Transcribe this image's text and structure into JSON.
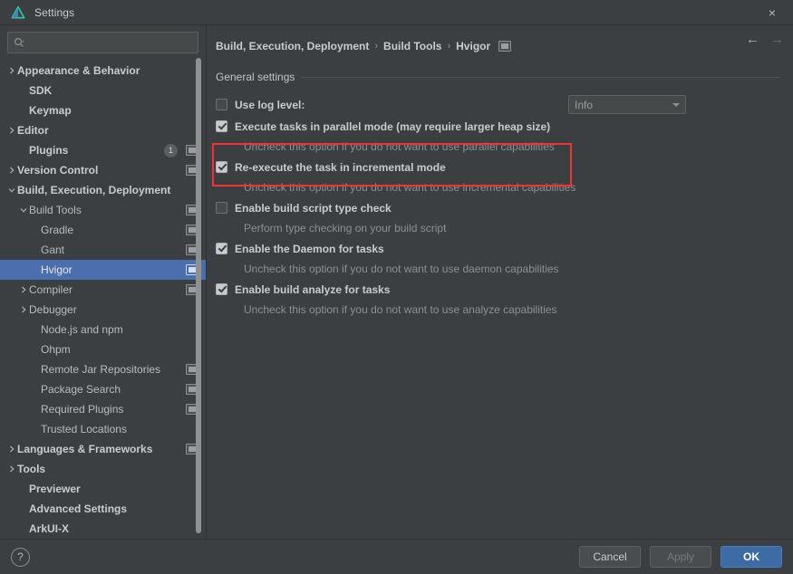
{
  "window": {
    "title": "Settings",
    "app_icon": "deveco-logo-icon",
    "close_label": "×"
  },
  "sidebar": {
    "search": {
      "value": "",
      "placeholder": "",
      "icon": "search-icon"
    },
    "items": [
      {
        "label": "Appearance & Behavior",
        "indent": 0,
        "arrow": "›",
        "bold": true,
        "selected": false,
        "module_icon": false,
        "badge": ""
      },
      {
        "label": "SDK",
        "indent": 1,
        "arrow": "",
        "bold": true,
        "selected": false,
        "module_icon": false,
        "badge": ""
      },
      {
        "label": "Keymap",
        "indent": 1,
        "arrow": "",
        "bold": true,
        "selected": false,
        "module_icon": false,
        "badge": ""
      },
      {
        "label": "Editor",
        "indent": 0,
        "arrow": "›",
        "bold": true,
        "selected": false,
        "module_icon": false,
        "badge": ""
      },
      {
        "label": "Plugins",
        "indent": 1,
        "arrow": "",
        "bold": true,
        "selected": false,
        "module_icon": true,
        "badge": "1"
      },
      {
        "label": "Version Control",
        "indent": 0,
        "arrow": "›",
        "bold": true,
        "selected": false,
        "module_icon": true,
        "badge": ""
      },
      {
        "label": "Build, Execution, Deployment",
        "indent": 0,
        "arrow": "∨",
        "bold": true,
        "selected": false,
        "module_icon": false,
        "badge": ""
      },
      {
        "label": "Build Tools",
        "indent": 1,
        "arrow": "∨",
        "bold": false,
        "selected": false,
        "module_icon": true,
        "badge": ""
      },
      {
        "label": "Gradle",
        "indent": 2,
        "arrow": "",
        "bold": false,
        "selected": false,
        "module_icon": true,
        "badge": ""
      },
      {
        "label": "Gant",
        "indent": 2,
        "arrow": "",
        "bold": false,
        "selected": false,
        "module_icon": true,
        "badge": ""
      },
      {
        "label": "Hvigor",
        "indent": 2,
        "arrow": "",
        "bold": false,
        "selected": true,
        "module_icon": true,
        "badge": ""
      },
      {
        "label": "Compiler",
        "indent": 1,
        "arrow": "›",
        "bold": false,
        "selected": false,
        "module_icon": true,
        "badge": ""
      },
      {
        "label": "Debugger",
        "indent": 1,
        "arrow": "›",
        "bold": false,
        "selected": false,
        "module_icon": false,
        "badge": ""
      },
      {
        "label": "Node.js and npm",
        "indent": 2,
        "arrow": "",
        "bold": false,
        "selected": false,
        "module_icon": false,
        "badge": ""
      },
      {
        "label": "Ohpm",
        "indent": 2,
        "arrow": "",
        "bold": false,
        "selected": false,
        "module_icon": false,
        "badge": ""
      },
      {
        "label": "Remote Jar Repositories",
        "indent": 2,
        "arrow": "",
        "bold": false,
        "selected": false,
        "module_icon": true,
        "badge": ""
      },
      {
        "label": "Package Search",
        "indent": 2,
        "arrow": "",
        "bold": false,
        "selected": false,
        "module_icon": true,
        "badge": ""
      },
      {
        "label": "Required Plugins",
        "indent": 2,
        "arrow": "",
        "bold": false,
        "selected": false,
        "module_icon": true,
        "badge": ""
      },
      {
        "label": "Trusted Locations",
        "indent": 2,
        "arrow": "",
        "bold": false,
        "selected": false,
        "module_icon": false,
        "badge": ""
      },
      {
        "label": "Languages & Frameworks",
        "indent": 0,
        "arrow": "›",
        "bold": true,
        "selected": false,
        "module_icon": true,
        "badge": ""
      },
      {
        "label": "Tools",
        "indent": 0,
        "arrow": "›",
        "bold": true,
        "selected": false,
        "module_icon": false,
        "badge": ""
      },
      {
        "label": "Previewer",
        "indent": 1,
        "arrow": "",
        "bold": true,
        "selected": false,
        "module_icon": false,
        "badge": ""
      },
      {
        "label": "Advanced Settings",
        "indent": 1,
        "arrow": "",
        "bold": true,
        "selected": false,
        "module_icon": false,
        "badge": ""
      },
      {
        "label": "ArkUI-X",
        "indent": 1,
        "arrow": "",
        "bold": true,
        "selected": false,
        "module_icon": false,
        "badge": ""
      }
    ]
  },
  "content": {
    "breadcrumb": {
      "parts": [
        "Build, Execution, Deployment",
        "Build Tools",
        "Hvigor"
      ],
      "separator": "›",
      "trailing_icon": "module-scope-icon"
    },
    "nav": {
      "back_icon": "arrow-left-icon",
      "forward_icon": "arrow-right-icon"
    },
    "group_title": "General settings",
    "log_level": {
      "label": "Use log level:",
      "checked": false,
      "combo_value": "Info",
      "combo_icon": "chevron-down-icon"
    },
    "options": [
      {
        "label": "Execute tasks in parallel mode (may require larger heap size)",
        "checked": true,
        "description": "Uncheck this option if you do not want to use parallel capabilities",
        "highlighted": false
      },
      {
        "label": "Re-execute the task in incremental mode",
        "checked": true,
        "description": "Uncheck this option if you do not want to use incremental capabilities",
        "highlighted": true
      },
      {
        "label": "Enable build script type check",
        "checked": false,
        "description": "Perform type checking on your build script",
        "highlighted": false
      },
      {
        "label": "Enable the Daemon for tasks",
        "checked": true,
        "description": "Uncheck this option if you do not want to use daemon capabilities",
        "highlighted": false
      },
      {
        "label": "Enable build analyze for tasks",
        "checked": true,
        "description": "Uncheck this option if you do not want to use analyze capabilities",
        "highlighted": false
      }
    ]
  },
  "footer": {
    "help_label": "?",
    "cancel_label": "Cancel",
    "apply_label": "Apply",
    "apply_disabled": true,
    "ok_label": "OK"
  },
  "colors": {
    "window_bg": "#3c3f41",
    "selection_blue": "#4b6eaf",
    "primary_button": "#3c6ba5",
    "highlight_red": "#f03333",
    "logo_teal": "#2ec4a6"
  }
}
